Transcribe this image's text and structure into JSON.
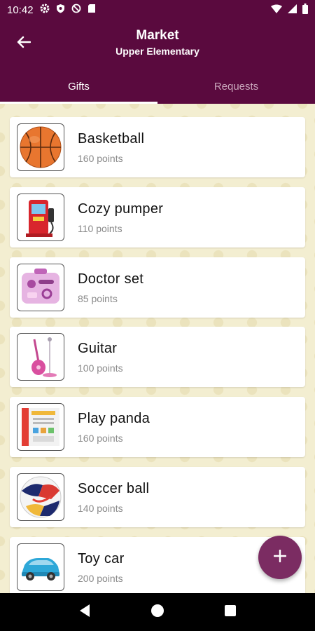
{
  "status_bar": {
    "time": "10:42",
    "icons": [
      "settings-icon",
      "shield-icon",
      "no-tracking-icon",
      "sd-card-icon",
      "wifi-icon",
      "cell-signal-icon",
      "battery-icon"
    ]
  },
  "header": {
    "title": "Market",
    "subtitle": "Upper Elementary",
    "back_icon": "arrow-back-icon"
  },
  "tabs": [
    {
      "label": "Gifts",
      "active": true
    },
    {
      "label": "Requests",
      "active": false
    }
  ],
  "gifts": [
    {
      "name": "Basketball",
      "points": "160 points",
      "icon": "basketball-image"
    },
    {
      "name": "Cozy pumper",
      "points": "110 points",
      "icon": "toy-gas-pump-image"
    },
    {
      "name": "Doctor set",
      "points": "85 points",
      "icon": "doctor-set-image"
    },
    {
      "name": "Guitar",
      "points": "100 points",
      "icon": "toy-guitar-image"
    },
    {
      "name": "Play panda",
      "points": "160 points",
      "icon": "play-panda-image"
    },
    {
      "name": "Soccer ball",
      "points": "140 points",
      "icon": "soccer-ball-image"
    },
    {
      "name": "Toy car",
      "points": "200 points",
      "icon": "toy-car-image"
    }
  ],
  "fab": {
    "icon": "plus-icon"
  },
  "nav": {
    "icons": [
      "back-triangle-icon",
      "home-circle-icon",
      "recents-square-icon"
    ]
  },
  "colors": {
    "primary": "#5a0a3e",
    "accent": "#7b2c62",
    "background": "#f3eed1"
  }
}
